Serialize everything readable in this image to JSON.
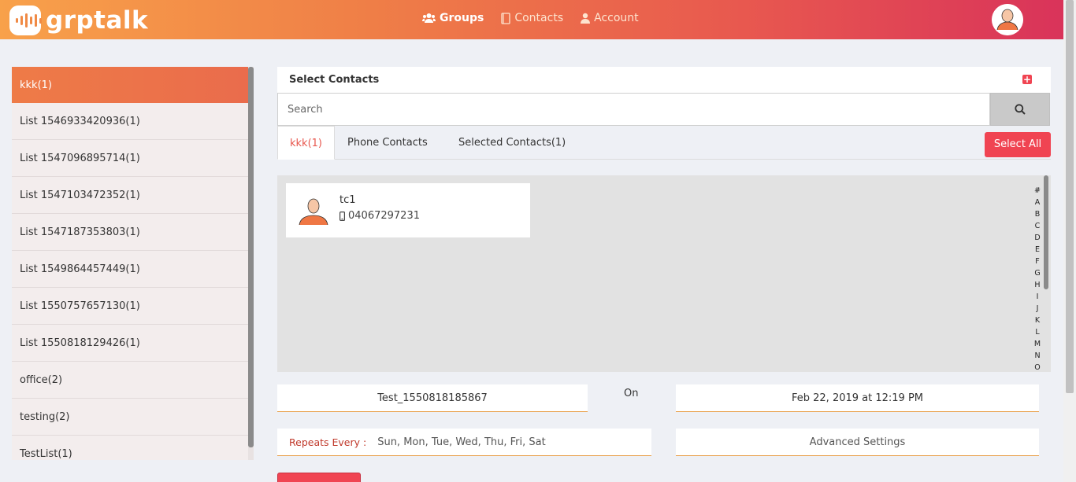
{
  "app": {
    "name": "grptalk"
  },
  "nav": [
    {
      "label": "Groups",
      "icon": "users-icon",
      "state": "active"
    },
    {
      "label": "Contacts",
      "icon": "contacts-book-icon",
      "state": "normal"
    },
    {
      "label": "Account",
      "icon": "user-icon",
      "state": "normal"
    }
  ],
  "sidebar": {
    "items": [
      {
        "label": "kkk(1)",
        "active": true
      },
      {
        "label": "List 1546933420936(1)"
      },
      {
        "label": "List 1547096895714(1)"
      },
      {
        "label": "List 1547103472352(1)"
      },
      {
        "label": "List 1547187353803(1)"
      },
      {
        "label": "List 1549864457449(1)"
      },
      {
        "label": "List 1550757657130(1)"
      },
      {
        "label": "List 1550818129426(1)"
      },
      {
        "label": "office(2)"
      },
      {
        "label": "testing(2)"
      },
      {
        "label": "TestList(1)"
      }
    ]
  },
  "panel": {
    "title": "Select Contacts",
    "add_icon": "plus-square-icon"
  },
  "search": {
    "placeholder": "Search",
    "value": ""
  },
  "tabs": [
    {
      "label": "kkk(1)",
      "active": true
    },
    {
      "label": "Phone Contacts"
    },
    {
      "label": "Selected Contacts(1)"
    }
  ],
  "select_all_label": "Select All",
  "contacts": [
    {
      "name": "tc1",
      "phone": "04067297231"
    }
  ],
  "alphabet": [
    "#",
    "A",
    "B",
    "C",
    "D",
    "E",
    "F",
    "G",
    "H",
    "I",
    "J",
    "K",
    "L",
    "M",
    "N",
    "O"
  ],
  "schedule": {
    "group_name": "Test_1550818185867",
    "on_label": "On",
    "datetime": "Feb 22, 2019 at 12:19 PM",
    "repeats_label": "Repeats Every :",
    "repeats_days": "Sun, Mon, Tue, Wed, Thu, Fri, Sat",
    "advanced_label": "Advanced Settings"
  },
  "colors": {
    "accent": "#f04452",
    "header_start": "#f8a14a",
    "header_end": "#d9335a",
    "sidebar_active": "#ee7b47"
  }
}
